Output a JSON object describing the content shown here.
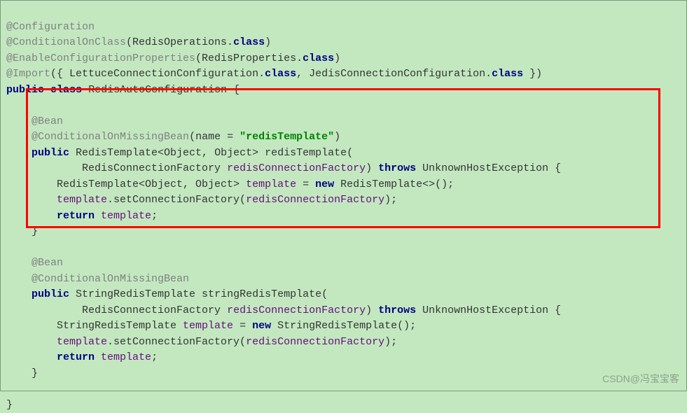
{
  "lines": {
    "l1_anno": "@Configuration",
    "l2_anno": "@ConditionalOnClass",
    "l2_p1": "(RedisOperations.",
    "l2_kw": "class",
    "l2_p2": ")",
    "l3_anno": "@EnableConfigurationProperties",
    "l3_p1": "(RedisProperties.",
    "l3_kw": "class",
    "l3_p2": ")",
    "l4_anno": "@Import",
    "l4_p1": "({ LettuceConnectionConfiguration.",
    "l4_kw1": "class",
    "l4_p2": ", JedisConnectionConfiguration.",
    "l4_kw2": "class",
    "l4_p3": " })",
    "l5_kw1": "public",
    "l5_kw2": "class",
    "l5_name": "RedisAutoConfiguration {",
    "l7_anno": "@Bean",
    "l8_anno": "@ConditionalOnMissingBean",
    "l8_p1": "(name = ",
    "l8_str": "\"redisTemplate\"",
    "l8_p2": ")",
    "l9_kw": "public",
    "l9_sig": " RedisTemplate<Object, Object> redisTemplate(",
    "l10_p1": "            RedisConnectionFactory ",
    "l10_param": "redisConnectionFactory",
    "l10_p2": ") ",
    "l10_kw": "throws",
    "l10_p3": " UnknownHostException {",
    "l11_p1": "        RedisTemplate<Object, Object> ",
    "l11_var": "template",
    "l11_p2": " = ",
    "l11_kw": "new",
    "l11_p3": " RedisTemplate<>();",
    "l12_p1": "        ",
    "l12_var": "template",
    "l12_p2": ".setConnectionFactory(",
    "l12_param": "redisConnectionFactory",
    "l12_p3": ");",
    "l13_p1": "        ",
    "l13_kw": "return",
    "l13_p2": " ",
    "l13_var": "template",
    "l13_p3": ";",
    "l14": "    }",
    "l16_anno": "@Bean",
    "l17_anno": "@ConditionalOnMissingBean",
    "l18_kw": "public",
    "l18_sig": " StringRedisTemplate stringRedisTemplate(",
    "l19_p1": "            RedisConnectionFactory ",
    "l19_param": "redisConnectionFactory",
    "l19_p2": ") ",
    "l19_kw": "throws",
    "l19_p3": " UnknownHostException {",
    "l20_p1": "        StringRedisTemplate ",
    "l20_var": "template",
    "l20_p2": " = ",
    "l20_kw": "new",
    "l20_p3": " StringRedisTemplate();",
    "l21_p1": "        ",
    "l21_var": "template",
    "l21_p2": ".setConnectionFactory(",
    "l21_param": "redisConnectionFactory",
    "l21_p3": ");",
    "l22_p1": "        ",
    "l22_kw": "return",
    "l22_p2": " ",
    "l22_var": "template",
    "l22_p3": ";",
    "l23": "    }",
    "l25": "}"
  },
  "watermark": "CSDN@冯宝宝客"
}
